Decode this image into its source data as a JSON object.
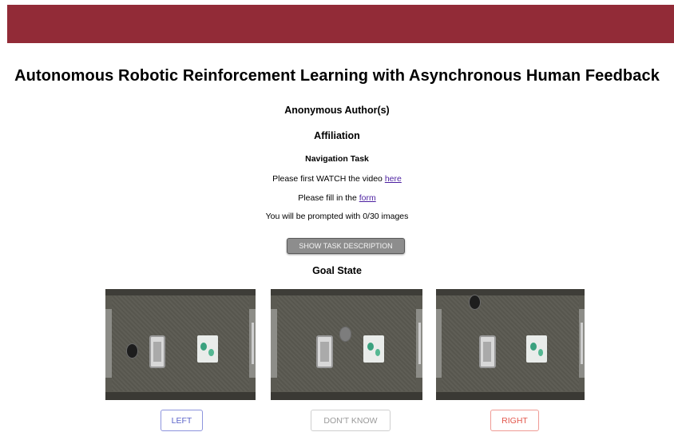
{
  "header": {
    "title": "Autonomous Robotic Reinforcement Learning with Asynchronous Human Feedback",
    "authors": "Anonymous Author(s)",
    "affiliation": "Affiliation",
    "colors": {
      "banner": "#922b37"
    }
  },
  "task": {
    "name": "Navigation Task",
    "watch_prefix": "Please first WATCH the video ",
    "watch_link": "here",
    "form_prefix": "Please fill in the ",
    "form_link": "form",
    "prompt_text": "You will be prompted with 0/30 images",
    "show_description_label": "SHOW TASK DESCRIPTION"
  },
  "goal": {
    "heading": "Goal State"
  },
  "images": [
    {
      "name": "left-option-image",
      "description": "top-down robot navigation scene"
    },
    {
      "name": "goal-state-image",
      "description": "top-down robot navigation scene"
    },
    {
      "name": "right-option-image",
      "description": "top-down robot navigation scene"
    }
  ],
  "choices": {
    "left_label": "LEFT",
    "dont_know_label": "DON'T KNOW",
    "right_label": "RIGHT",
    "colors": {
      "left": "#5b64c9",
      "dont_know": "#9a9a9a",
      "right": "#e2574c"
    }
  }
}
